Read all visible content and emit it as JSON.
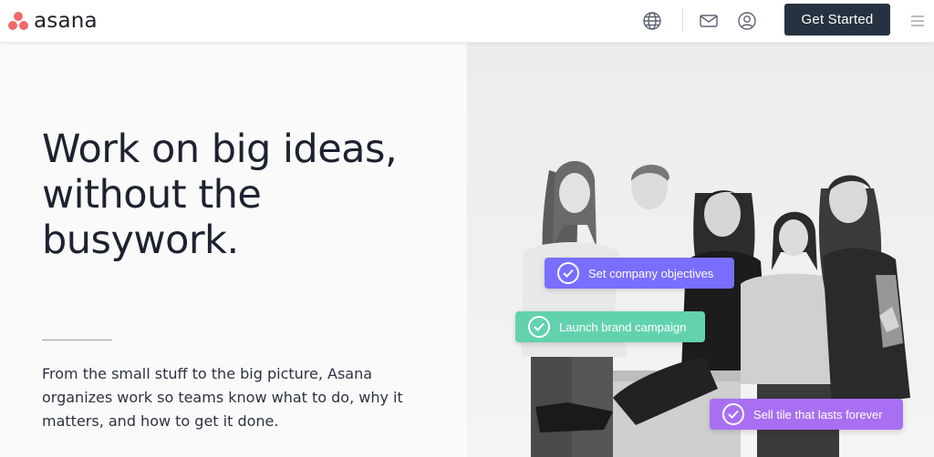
{
  "brand": {
    "name": "asana",
    "dot_colors": [
      "#f06a6a",
      "#f06a6a",
      "#f06a6a"
    ]
  },
  "header": {
    "icons": [
      "globe-icon",
      "mail-icon",
      "user-icon",
      "menu-icon"
    ],
    "cta_label": "Get Started",
    "cta_color": "#273240"
  },
  "hero": {
    "headline": "Work on big ideas, without the busywork.",
    "description": "From the small stuff to the big picture, Asana organizes work so teams know what to do, why it matters, and how to get it done."
  },
  "tasks": [
    {
      "label": "Set company objectives",
      "color": "#796eff"
    },
    {
      "label": "Launch brand campaign",
      "color": "#62d2ae"
    },
    {
      "label": "Sell tile that lasts forever",
      "color": "#a86ff2"
    }
  ]
}
